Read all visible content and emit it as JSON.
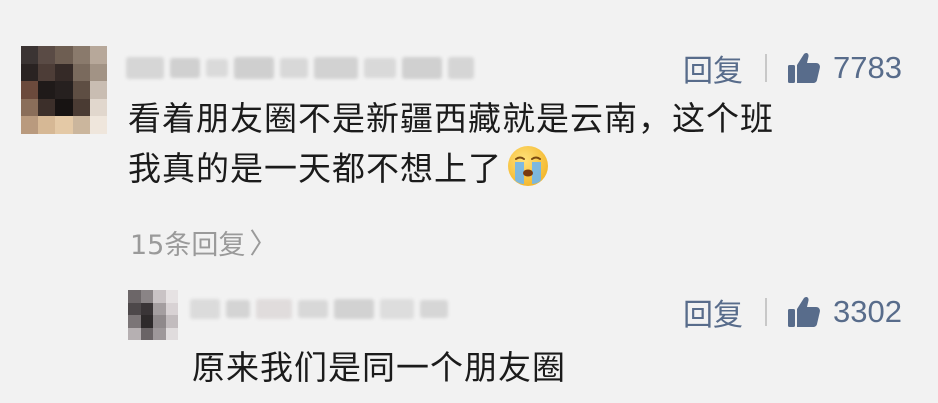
{
  "comment": {
    "reply_label": "回复",
    "like_count": "7783",
    "text_line1": "看着朋友圈不是新疆西藏就是云南，这个班",
    "text_line2": "我真的是一天都不想上了",
    "emoji": "crying-face",
    "more_replies": "15条回复",
    "more_replies_chevron": "〉"
  },
  "reply": {
    "reply_label": "回复",
    "like_count": "3302",
    "text": "原来我们是同一个朋友圈"
  },
  "colors": {
    "background": "#f2f2f2",
    "action": "#586c8b",
    "text": "#1b1b1b",
    "muted": "#9a9a9a"
  }
}
